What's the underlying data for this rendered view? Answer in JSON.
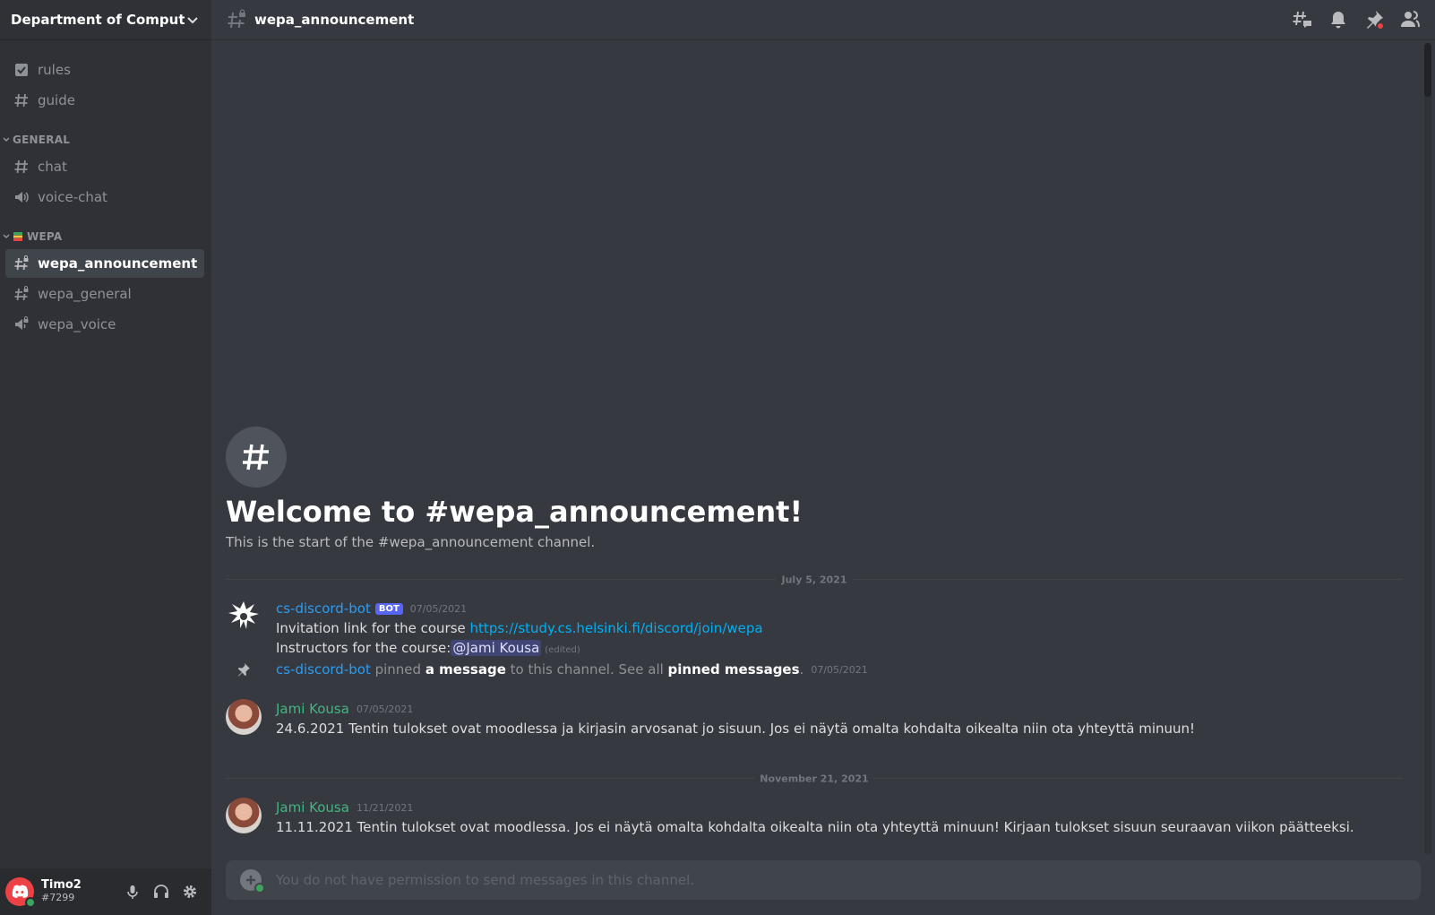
{
  "server": {
    "name": "Department of Compute..."
  },
  "channels_top": [
    {
      "label": "rules",
      "icon": "rules-check-icon"
    },
    {
      "label": "guide",
      "icon": "hash-icon"
    }
  ],
  "categories": [
    {
      "label": "GENERAL",
      "channels": [
        {
          "label": "chat",
          "icon": "hash-icon"
        },
        {
          "label": "voice-chat",
          "icon": "speaker-icon"
        }
      ]
    },
    {
      "label": "WEPA",
      "channels": [
        {
          "label": "wepa_announcement",
          "icon": "hash-lock-icon",
          "active": true
        },
        {
          "label": "wepa_general",
          "icon": "hash-lock-icon"
        },
        {
          "label": "wepa_voice",
          "icon": "speaker-lock-icon"
        }
      ]
    }
  ],
  "user": {
    "name": "Timo2",
    "tag": "#7299"
  },
  "header": {
    "channel": "wepa_announcement"
  },
  "welcome": {
    "title": "Welcome to #wepa_announcement!",
    "subtitle": "This is the start of the #wepa_announcement channel."
  },
  "dividers": {
    "first": "July 5, 2021",
    "second": "November 21, 2021"
  },
  "messages": [
    {
      "author": "cs-discord-bot",
      "bot_tag": "BOT",
      "timestamp": "07/05/2021",
      "line1_text": "Invitation link for the course ",
      "line1_link": "https://study.cs.helsinki.fi/discord/join/wepa",
      "line2_text": "Instructors for the course:",
      "line2_mention": "@Jami Kousa",
      "edited": "(edited)"
    },
    {
      "author": "Jami Kousa",
      "timestamp": "07/05/2021",
      "text": "24.6.2021 Tentin tulokset ovat moodlessa ja kirjasin arvosanat jo sisuun. Jos ei näytä omalta kohdalta oikealta niin ota yhteyttä minuun!"
    },
    {
      "author": "Jami Kousa",
      "timestamp": "11/21/2021",
      "text": "11.11.2021 Tentin tulokset ovat moodlessa. Jos ei näytä omalta kohdalta oikealta niin ota yhteyttä minuun! Kirjaan tulokset sisuun seuraavan viikon päätteeksi."
    }
  ],
  "system_message": {
    "author": "cs-discord-bot",
    "pinned": " pinned ",
    "a_message": "a message",
    "mid": " to this channel. See all ",
    "pinned_messages": "pinned messages",
    "dot": ".",
    "timestamp": "07/05/2021"
  },
  "composer": {
    "placeholder": "You do not have permission to send messages in this channel."
  },
  "colors": {
    "accent": "#5865f2",
    "link": "#00aff4",
    "online": "#3ba55d",
    "bot_name": "#2b9cf2",
    "user_green": "#43b581"
  }
}
